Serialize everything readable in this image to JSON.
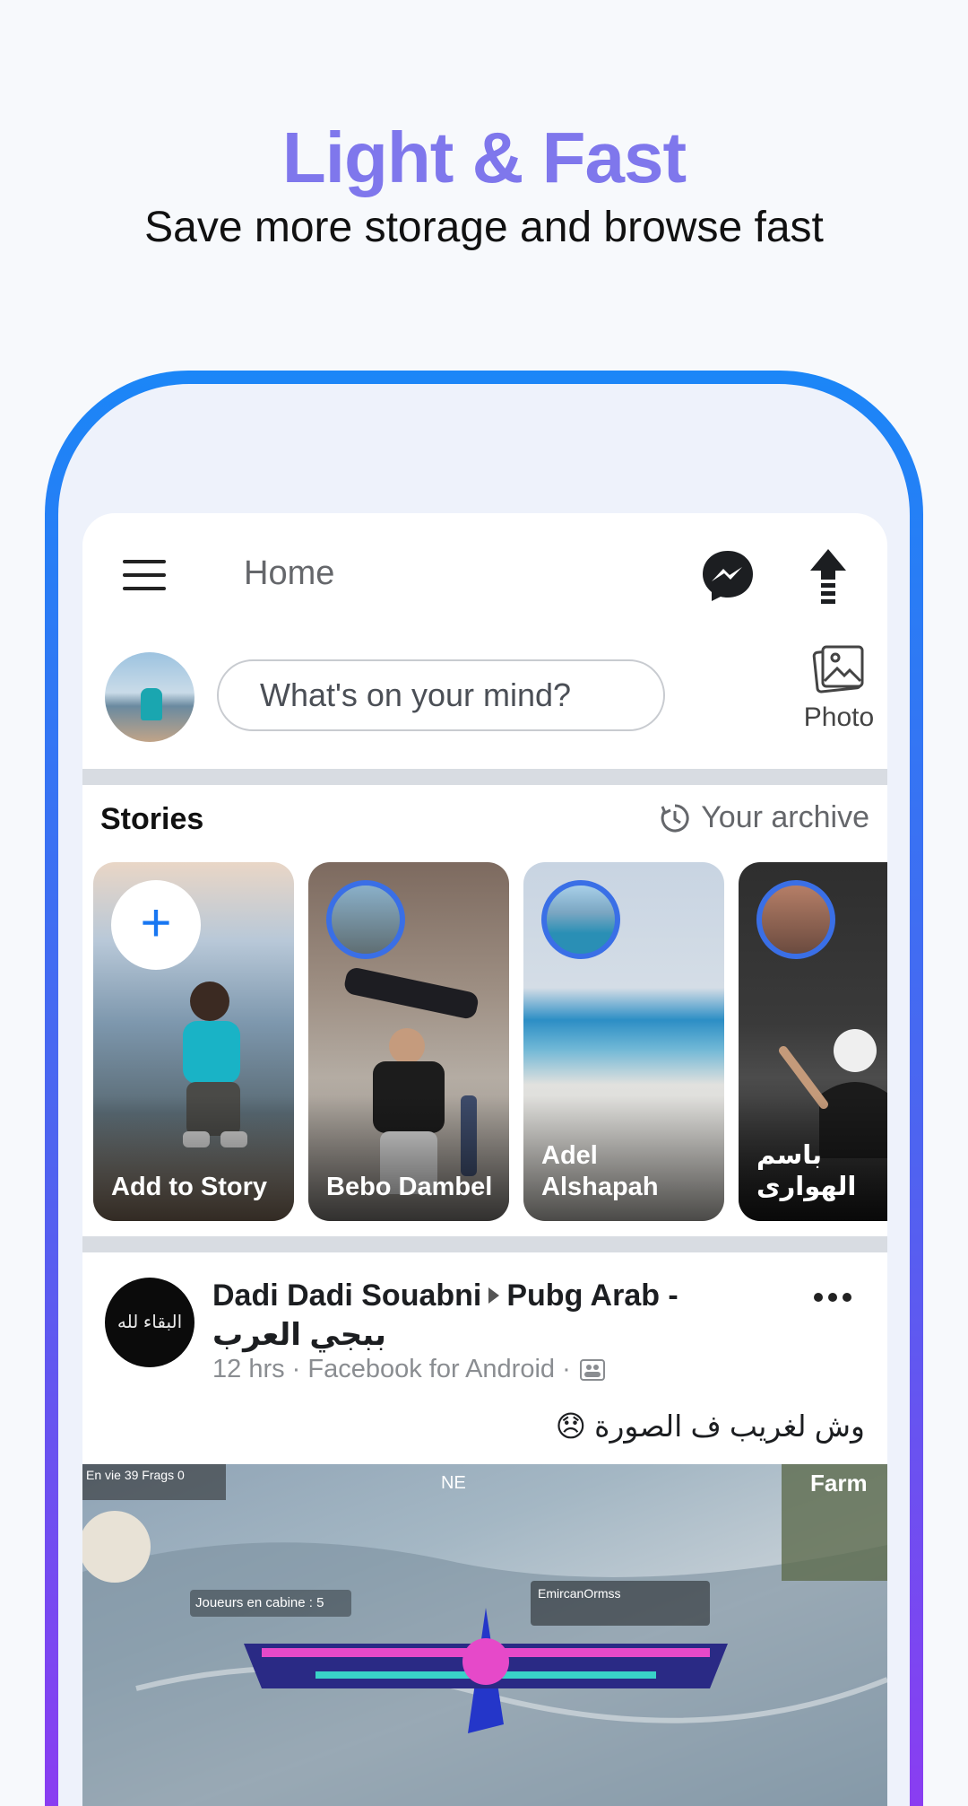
{
  "hero": {
    "title": "Light & Fast",
    "subtitle": "Save more storage and browse fast"
  },
  "topbar": {
    "title": "Home",
    "icons": [
      "menu-icon",
      "messenger-icon",
      "upload-arrow-icon"
    ]
  },
  "composer": {
    "placeholder": "What's on your mind?",
    "photo_label": "Photo"
  },
  "stories": {
    "title": "Stories",
    "archive_label": "Your archive",
    "items": [
      {
        "name": "Add to Story",
        "type": "add"
      },
      {
        "name": "Bebo Dambel",
        "type": "story"
      },
      {
        "name": "Adel Alshapah",
        "type": "story"
      },
      {
        "name": "باسم الهوارى",
        "type": "story"
      }
    ]
  },
  "post": {
    "author": "Dadi Dadi Souabni",
    "group": "Pubg Arab - ببجي العرب",
    "meta": "12 hrs · Facebook for Android ·",
    "text": "وش لغريب ف الصورة 😞",
    "avatar_text": "البقاء لله",
    "image_labels": {
      "en_vie": "En vie",
      "en_vie_count": "39",
      "frags": "Frags",
      "frags_count": "0",
      "compass_ne": "NE",
      "farm": "Farm",
      "cabin": "Joueurs en cabine : 5",
      "player": "EmircanOrmss"
    }
  },
  "colors": {
    "accent": "#7f77ec",
    "frame_top": "#1b86f7",
    "frame_bottom": "#8a3df1",
    "story_ring": "#3a6fe6",
    "add_plus": "#1877f2"
  }
}
